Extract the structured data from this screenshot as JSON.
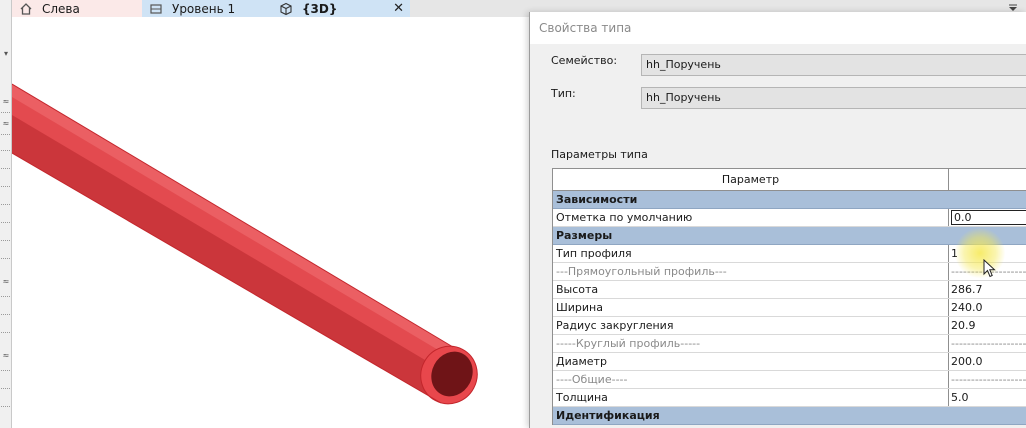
{
  "tabs": [
    {
      "label": "Слева",
      "icon": "home-icon"
    },
    {
      "label": "Уровень 1",
      "icon": "level-view-icon"
    },
    {
      "label": "{3D}",
      "icon": "3d-view-icon",
      "close": "✕"
    }
  ],
  "colors": {
    "pipe": "#e8474c",
    "group_header": "#a9bfd9",
    "tab_active": "#cfe3f5",
    "tab_left": "#fbe9e8"
  },
  "dialog": {
    "title": "Свойства типа",
    "family_label": "Семейство:",
    "family_value": "hh_Поручень",
    "type_label": "Тип:",
    "type_value": "hh_Поручень",
    "section_label": "Параметры типа",
    "table": {
      "header_param": "Параметр",
      "header_value": "",
      "rows": [
        {
          "kind": "group",
          "name": "Зависимости"
        },
        {
          "kind": "param",
          "name": "Отметка по умолчанию",
          "value": "0.0"
        },
        {
          "kind": "group",
          "name": "Размеры"
        },
        {
          "kind": "param",
          "name": "Тип профиля",
          "value": "1"
        },
        {
          "kind": "sep",
          "name": "---Прямоугольный профиль---",
          "value": "-------------------"
        },
        {
          "kind": "param",
          "name": "Высота",
          "value": "286.7"
        },
        {
          "kind": "param",
          "name": "Ширина",
          "value": "240.0"
        },
        {
          "kind": "param",
          "name": "Радиус закругления",
          "value": "20.9"
        },
        {
          "kind": "sep",
          "name": "-----Круглый профиль-----",
          "value": "-------------------"
        },
        {
          "kind": "param",
          "name": "Диаметр",
          "value": "200.0"
        },
        {
          "kind": "sep",
          "name": "----Общие----",
          "value": "-------------------"
        },
        {
          "kind": "param",
          "name": "Толщина",
          "value": "5.0"
        },
        {
          "kind": "group",
          "name": "Идентификация"
        }
      ]
    }
  }
}
